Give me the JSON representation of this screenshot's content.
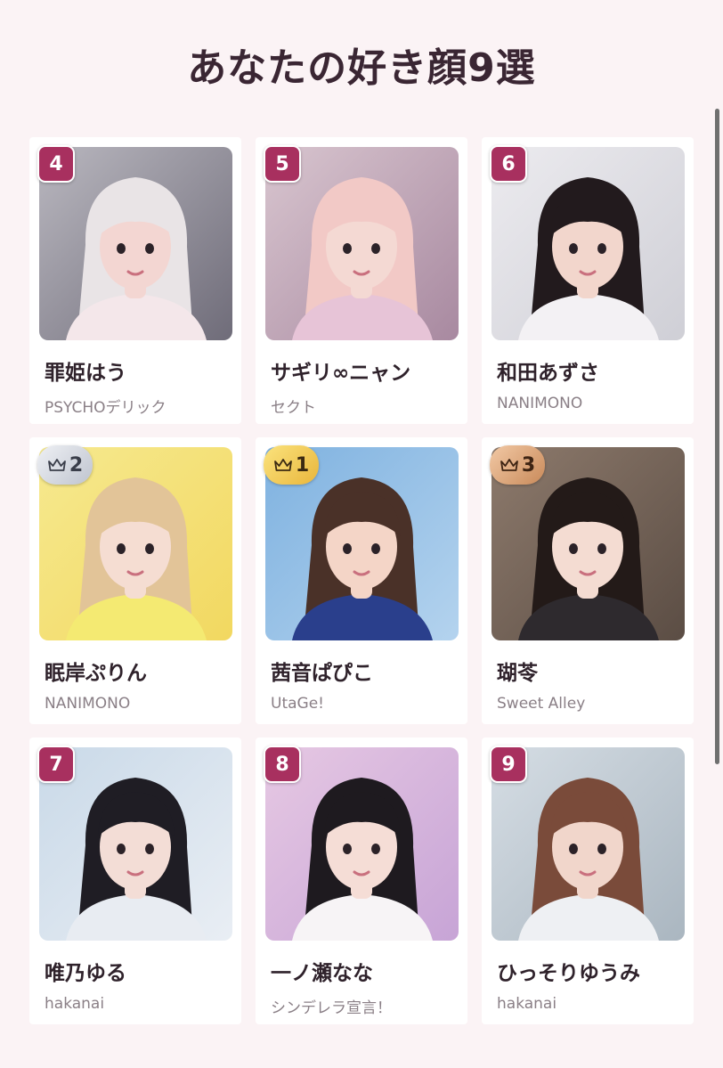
{
  "page": {
    "title": "あなたの好き顔9選"
  },
  "colors": {
    "accent": "#a8305f",
    "background": "#fbf3f5",
    "name_text": "#2f222b",
    "group_text": "#8a7f86"
  },
  "cards": [
    {
      "rank": "4",
      "rank_style": "number",
      "name": "罪姫はう",
      "group": "PSYCHOデリック",
      "photo": "photo-portrait",
      "bg": "#b9b7bf",
      "bg2": "#6f6c79",
      "hair": "#e9e4e6",
      "skin": "#f3d6d2",
      "outfit": "#f4e7ea"
    },
    {
      "rank": "5",
      "rank_style": "number",
      "name": "サギリ∞ニャン",
      "group": "セクト",
      "photo": "photo-portrait",
      "bg": "#d8c5cf",
      "bg2": "#a889a0",
      "hair": "#f2c9c6",
      "skin": "#f4d9d3",
      "outfit": "#e7c4d7"
    },
    {
      "rank": "6",
      "rank_style": "number",
      "name": "和田あずさ",
      "group": "NANIMONO",
      "photo": "photo-portrait",
      "bg": "#ecebef",
      "bg2": "#cfcfd6",
      "hair": "#221a1d",
      "skin": "#f2d6cc",
      "outfit": "#f3f1f4"
    },
    {
      "rank": "2",
      "rank_style": "silver",
      "name": "眠岸ぷりん",
      "group": "NANIMONO",
      "photo": "photo-portrait",
      "bg": "#f6e98f",
      "bg2": "#f2d860",
      "hair": "#e2c498",
      "skin": "#f5ddd2",
      "outfit": "#f4ea72"
    },
    {
      "rank": "1",
      "rank_style": "gold",
      "name": "茜音ぱぴこ",
      "group": "UtaGe!",
      "photo": "photo-portrait",
      "bg": "#7fb2e0",
      "bg2": "#b4d3ee",
      "hair": "#4a3128",
      "skin": "#f4d5c7",
      "outfit": "#2a3f8c"
    },
    {
      "rank": "3",
      "rank_style": "bronze",
      "name": "瑚苓",
      "group": "Sweet Alley",
      "photo": "photo-portrait",
      "bg": "#8d7a6c",
      "bg2": "#5b4d44",
      "hair": "#231a18",
      "skin": "#f4dcd2",
      "outfit": "#2e2a2e"
    },
    {
      "rank": "7",
      "rank_style": "number",
      "name": "唯乃ゆる",
      "group": "hakanai",
      "photo": "photo-portrait",
      "bg": "#c9d9e8",
      "bg2": "#e9eef4",
      "hair": "#1f1d24",
      "skin": "#f3ddd6",
      "outfit": "#e8ecf2"
    },
    {
      "rank": "8",
      "rank_style": "number",
      "name": "一ノ瀬なな",
      "group": "シンデレラ宣言！",
      "photo": "photo-portrait",
      "bg": "#e6c8e3",
      "bg2": "#c7a4d6",
      "hair": "#1e1a1f",
      "skin": "#f5ddd6",
      "outfit": "#f7f4f6"
    },
    {
      "rank": "9",
      "rank_style": "number",
      "name": "ひっそりゆうみ",
      "group": "hakanai",
      "photo": "photo-portrait",
      "bg": "#d5dde4",
      "bg2": "#aab6c0",
      "hair": "#7a4b3a",
      "skin": "#f1d6cb",
      "outfit": "#eef0f3"
    }
  ]
}
